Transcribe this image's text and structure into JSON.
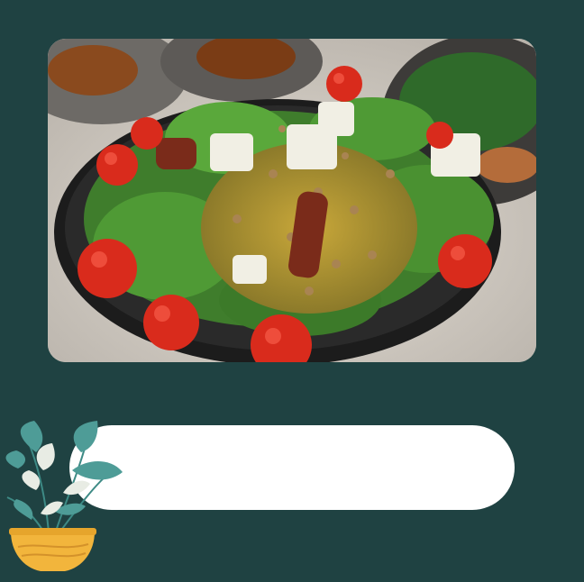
{
  "photo": {
    "subject": "salad-bowl-photo"
  },
  "caption": {
    "text": ""
  },
  "decor": {
    "plant": "potted-plant-icon"
  },
  "colors": {
    "background": "#1f4242",
    "pill": "#ffffff",
    "leaf": "#4e9c97",
    "leaf_light": "#e8ece4",
    "pot": "#f2b53c"
  }
}
